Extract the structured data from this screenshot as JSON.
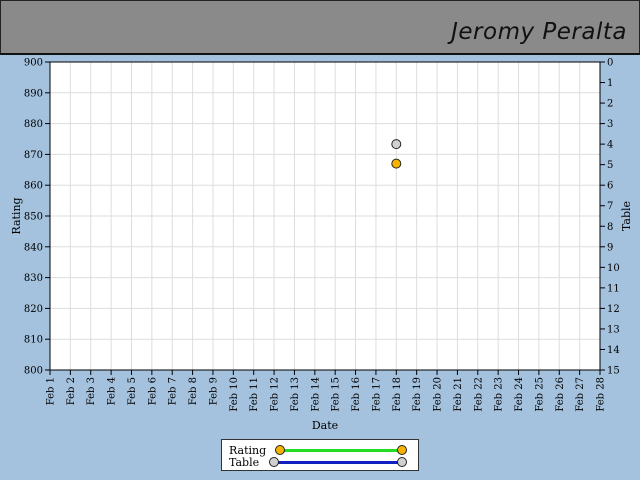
{
  "player": {
    "name": "Jeromy Peralta"
  },
  "colors": {
    "rating_marker": "#f7b200",
    "table_marker": "#d0d0d0",
    "rating_line": "#22dd22",
    "table_line": "#1020c0",
    "plot_background": "#ffffff",
    "grid": "#dddddd",
    "page_background": "#a4c2de",
    "header_background": "#8a8a8a"
  },
  "legend": {
    "rating_label": "Rating",
    "table_label": "Table",
    "placement": "bottom-center"
  },
  "chart_data": {
    "type": "scatter",
    "xlabel": "Date",
    "ylabel": "Rating",
    "y2label": "Table",
    "categories": [
      "Feb 1",
      "Feb 2",
      "Feb 3",
      "Feb 4",
      "Feb 5",
      "Feb 6",
      "Feb 7",
      "Feb 8",
      "Feb 9",
      "Feb 10",
      "Feb 11",
      "Feb 12",
      "Feb 13",
      "Feb 14",
      "Feb 15",
      "Feb 16",
      "Feb 17",
      "Feb 18",
      "Feb 19",
      "Feb 20",
      "Feb 21",
      "Feb 22",
      "Feb 23",
      "Feb 24",
      "Feb 25",
      "Feb 26",
      "Feb 27",
      "Feb 28"
    ],
    "ylim": [
      800,
      900
    ],
    "yticks": [
      800,
      810,
      820,
      830,
      840,
      850,
      860,
      870,
      880,
      890,
      900
    ],
    "y2lim": [
      15,
      0
    ],
    "y2ticks": [
      0,
      1,
      2,
      3,
      4,
      5,
      6,
      7,
      8,
      9,
      10,
      11,
      12,
      13,
      14,
      15
    ],
    "grid": true,
    "series": [
      {
        "name": "Rating",
        "axis": "left",
        "points": [
          {
            "x": "Feb 18",
            "y": 867
          }
        ]
      },
      {
        "name": "Table",
        "axis": "right",
        "points": [
          {
            "x": "Feb 18",
            "y": 4
          }
        ]
      }
    ]
  }
}
